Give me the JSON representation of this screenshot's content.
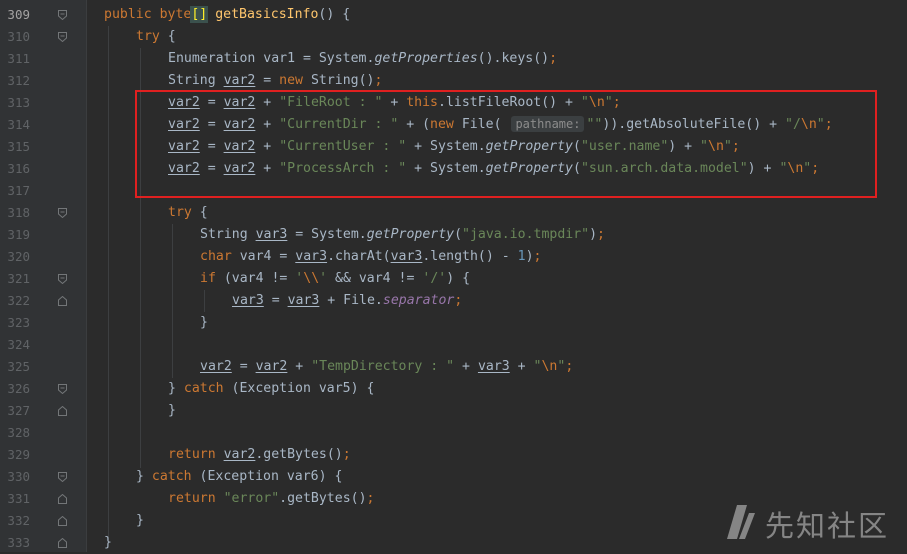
{
  "editor": {
    "language": "java",
    "current_line": 309,
    "lines": [
      {
        "no": 309,
        "text": "public byte[] getBasicsInfo() {"
      },
      {
        "no": 310,
        "text": "try {"
      },
      {
        "no": 311,
        "text": "Enumeration var1 = System.getProperties().keys();"
      },
      {
        "no": 312,
        "text": "String var2 = new String();"
      },
      {
        "no": 313,
        "text": "var2 = var2 + \"FileRoot : \" + this.listFileRoot() + \"\\n\";"
      },
      {
        "no": 314,
        "text": "var2 = var2 + \"CurrentDir : \" + (new File( pathname: \"\")).getAbsoluteFile() + \"/\\n\";"
      },
      {
        "no": 315,
        "text": "var2 = var2 + \"CurrentUser : \" + System.getProperty(\"user.name\") + \"\\n\";"
      },
      {
        "no": 316,
        "text": "var2 = var2 + \"ProcessArch : \" + System.getProperty(\"sun.arch.data.model\") + \"\\n\";"
      },
      {
        "no": 317,
        "text": ""
      },
      {
        "no": 318,
        "text": "try {"
      },
      {
        "no": 319,
        "text": "String var3 = System.getProperty(\"java.io.tmpdir\");"
      },
      {
        "no": 320,
        "text": "char var4 = var3.charAt(var3.length() - 1);"
      },
      {
        "no": 321,
        "text": "if (var4 != '\\\\' && var4 != '/') {"
      },
      {
        "no": 322,
        "text": "var3 = var3 + File.separator;"
      },
      {
        "no": 323,
        "text": "}"
      },
      {
        "no": 324,
        "text": ""
      },
      {
        "no": 325,
        "text": "var2 = var2 + \"TempDirectory : \" + var3 + \"\\n\";"
      },
      {
        "no": 326,
        "text": "} catch (Exception var5) {"
      },
      {
        "no": 327,
        "text": "}"
      },
      {
        "no": 328,
        "text": ""
      },
      {
        "no": 329,
        "text": "return var2.getBytes();"
      },
      {
        "no": 330,
        "text": "} catch (Exception var6) {"
      },
      {
        "no": 331,
        "text": "return \"error\".getBytes();"
      },
      {
        "no": 332,
        "text": "}"
      },
      {
        "no": 333,
        "text": "}"
      }
    ],
    "parameter_hint": "pathname:"
  },
  "annotation": {
    "box_color": "#e02020",
    "covers_lines": [
      313,
      316
    ]
  },
  "watermark": {
    "text": "先知社区",
    "icon": "xianzhi-logo-icon"
  },
  "colors": {
    "background": "#2b2b2b",
    "gutter": "#313335",
    "keyword": "#cc7832",
    "string": "#6a8759",
    "method": "#ffc66d",
    "static_field": "#9876aa",
    "number": "#6897bb",
    "text": "#a9b7c6"
  }
}
